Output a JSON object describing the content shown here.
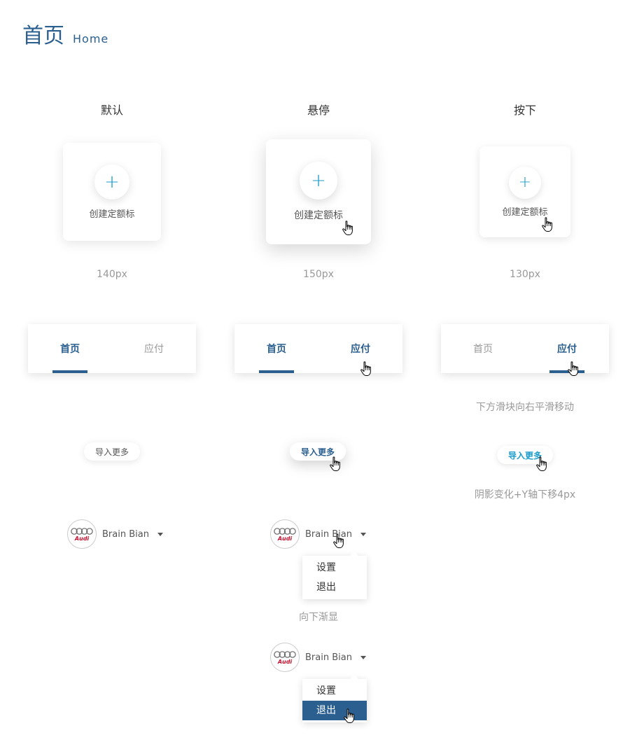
{
  "header": {
    "title_zh": "首页",
    "title_en": "Home"
  },
  "columns": {
    "default": "默认",
    "hover": "悬停",
    "pressed": "按下"
  },
  "cards": {
    "label": "创建定额标",
    "plus": "+",
    "size_default": "140px",
    "size_hover": "150px",
    "size_pressed": "130px"
  },
  "tabs": {
    "home": "首页",
    "payable": "应付",
    "note": "下方滑块向右平滑移动"
  },
  "import_button": {
    "label": "导入更多",
    "note": "阴影变化+Y轴下移4px"
  },
  "user": {
    "name": "Brain Bian",
    "logo_text": "Audi",
    "menu": [
      "设置",
      "退出"
    ],
    "note": "向下渐显"
  },
  "colors": {
    "primary": "#2a5f8f",
    "accent": "#1a9bcb",
    "muted": "#999999"
  }
}
